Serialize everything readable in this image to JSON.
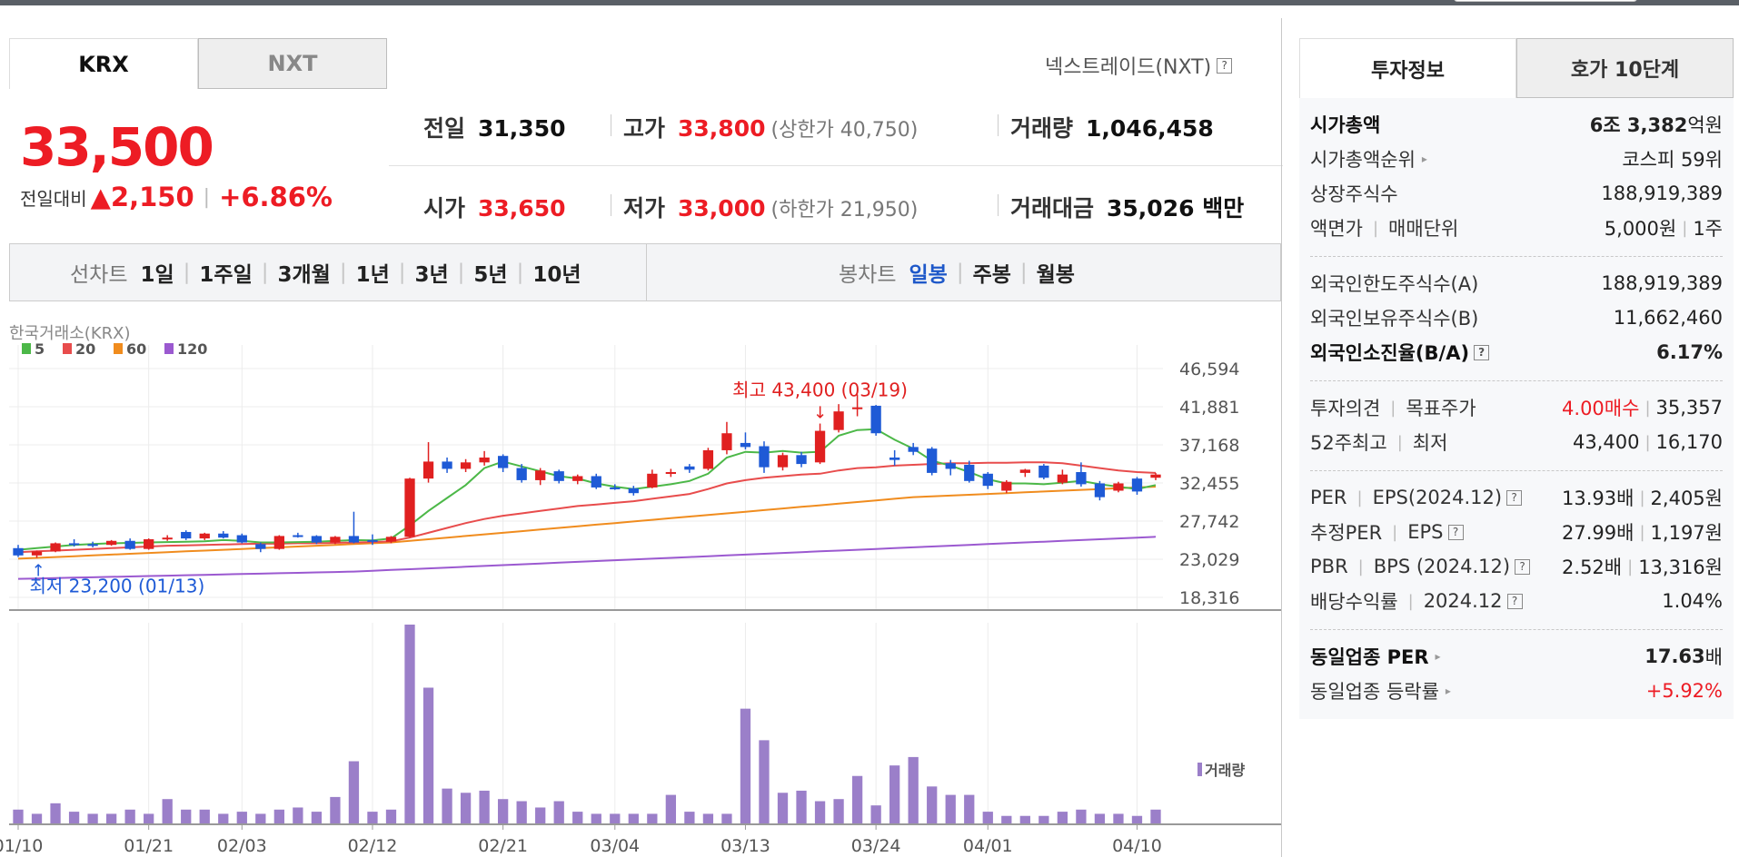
{
  "market_tabs": [
    {
      "label": "KRX",
      "active": true
    },
    {
      "label": "NXT",
      "active": false
    }
  ],
  "nxt_link": "넥스트레이드(NXT)",
  "price": {
    "current": "33,500",
    "change_label": "전일대비",
    "change_arrow": "▲",
    "change_amount": "2,150",
    "change_pct": "+6.86%"
  },
  "stats": {
    "prev": {
      "label": "전일",
      "value": "31,350"
    },
    "high": {
      "label": "고가",
      "value": "33,800",
      "limit": "(상한가 40,750)"
    },
    "volume": {
      "label": "거래량",
      "value": "1,046,458"
    },
    "open": {
      "label": "시가",
      "value": "33,650"
    },
    "low": {
      "label": "저가",
      "value": "33,000",
      "limit": "(하한가 21,950)"
    },
    "amount": {
      "label": "거래대금",
      "value": "35,026 백만"
    }
  },
  "period_bar": {
    "line_label": "선차트",
    "line_items": [
      "1일",
      "1주일",
      "3개월",
      "1년",
      "3년",
      "5년",
      "10년"
    ],
    "candle_label": "봉차트",
    "candle_items": [
      "일봉",
      "주봉",
      "월봉"
    ],
    "candle_selected": 0
  },
  "chart_data": {
    "type": "candlestick",
    "source_label": "한국거래소(KRX)",
    "legend": [
      {
        "name": "5",
        "color": "#4cb848"
      },
      {
        "name": "20",
        "color": "#e84c4c"
      },
      {
        "name": "60",
        "color": "#f08c1e"
      },
      {
        "name": "120",
        "color": "#9b59d0"
      }
    ],
    "volume_label": "거래량",
    "y_ticks": [
      "46,594",
      "41,881",
      "37,168",
      "32,455",
      "27,742",
      "23,029",
      "18,316"
    ],
    "ylim": [
      18316,
      46594
    ],
    "x_ticks": [
      "01/10",
      "01/21",
      "02/03",
      "02/12",
      "02/21",
      "03/04",
      "03/13",
      "03/24",
      "04/01",
      "04/10"
    ],
    "x_tick_index": [
      0,
      7,
      12,
      19,
      26,
      32,
      39,
      46,
      52,
      60
    ],
    "max_annotation": "최고 43,400 (03/19)",
    "max_index": 43,
    "min_annotation": "최저 23,200 (01/13)",
    "min_index": 1,
    "candles": [
      {
        "o": 24400,
        "h": 24800,
        "l": 23300,
        "c": 23500
      },
      {
        "o": 23500,
        "h": 24100,
        "l": 23200,
        "c": 24000
      },
      {
        "o": 24000,
        "h": 25100,
        "l": 23900,
        "c": 25000
      },
      {
        "o": 25000,
        "h": 25500,
        "l": 24600,
        "c": 24900
      },
      {
        "o": 24900,
        "h": 25200,
        "l": 24500,
        "c": 24800
      },
      {
        "o": 24800,
        "h": 25400,
        "l": 24700,
        "c": 25300
      },
      {
        "o": 25300,
        "h": 25600,
        "l": 24200,
        "c": 24300
      },
      {
        "o": 24300,
        "h": 25600,
        "l": 24200,
        "c": 25500
      },
      {
        "o": 25500,
        "h": 26000,
        "l": 25300,
        "c": 25700
      },
      {
        "o": 26400,
        "h": 26600,
        "l": 25400,
        "c": 25600
      },
      {
        "o": 25600,
        "h": 26300,
        "l": 25400,
        "c": 26200
      },
      {
        "o": 26200,
        "h": 26500,
        "l": 25600,
        "c": 25700
      },
      {
        "o": 26000,
        "h": 26200,
        "l": 25000,
        "c": 25100
      },
      {
        "o": 24900,
        "h": 25100,
        "l": 23900,
        "c": 24300
      },
      {
        "o": 24300,
        "h": 26000,
        "l": 24200,
        "c": 25900
      },
      {
        "o": 26000,
        "h": 26300,
        "l": 25700,
        "c": 25800
      },
      {
        "o": 25900,
        "h": 26000,
        "l": 24900,
        "c": 25100
      },
      {
        "o": 25100,
        "h": 25900,
        "l": 24900,
        "c": 25800
      },
      {
        "o": 25900,
        "h": 28900,
        "l": 25000,
        "c": 25100
      },
      {
        "o": 25400,
        "h": 26100,
        "l": 24800,
        "c": 25200
      },
      {
        "o": 25200,
        "h": 25900,
        "l": 25000,
        "c": 25800
      },
      {
        "o": 25800,
        "h": 33100,
        "l": 25700,
        "c": 33000
      },
      {
        "o": 33000,
        "h": 37500,
        "l": 32500,
        "c": 35100
      },
      {
        "o": 35100,
        "h": 35600,
        "l": 33700,
        "c": 34200
      },
      {
        "o": 34200,
        "h": 35400,
        "l": 33800,
        "c": 35000
      },
      {
        "o": 35000,
        "h": 36400,
        "l": 34600,
        "c": 35600
      },
      {
        "o": 35800,
        "h": 36000,
        "l": 33800,
        "c": 34300
      },
      {
        "o": 34300,
        "h": 34800,
        "l": 32500,
        "c": 32800
      },
      {
        "o": 32800,
        "h": 34300,
        "l": 32200,
        "c": 34000
      },
      {
        "o": 33900,
        "h": 34100,
        "l": 32400,
        "c": 32700
      },
      {
        "o": 32700,
        "h": 33500,
        "l": 32300,
        "c": 33300
      },
      {
        "o": 33300,
        "h": 33600,
        "l": 31700,
        "c": 31900
      },
      {
        "o": 31900,
        "h": 32300,
        "l": 31600,
        "c": 31800
      },
      {
        "o": 31800,
        "h": 32100,
        "l": 30900,
        "c": 31200
      },
      {
        "o": 31900,
        "h": 34100,
        "l": 31800,
        "c": 33600
      },
      {
        "o": 33700,
        "h": 34200,
        "l": 33200,
        "c": 33800
      },
      {
        "o": 34500,
        "h": 34800,
        "l": 33700,
        "c": 34100
      },
      {
        "o": 34200,
        "h": 36800,
        "l": 34000,
        "c": 36500
      },
      {
        "o": 36500,
        "h": 40000,
        "l": 36000,
        "c": 38600
      },
      {
        "o": 37400,
        "h": 38700,
        "l": 36600,
        "c": 36900
      },
      {
        "o": 37000,
        "h": 37600,
        "l": 33700,
        "c": 34400
      },
      {
        "o": 34400,
        "h": 36200,
        "l": 34000,
        "c": 35900
      },
      {
        "o": 35900,
        "h": 36300,
        "l": 34400,
        "c": 34800
      },
      {
        "o": 35000,
        "h": 39800,
        "l": 34800,
        "c": 38900
      },
      {
        "o": 39000,
        "h": 42200,
        "l": 38700,
        "c": 41300
      },
      {
        "o": 41800,
        "h": 43400,
        "l": 40700,
        "c": 41800
      },
      {
        "o": 42000,
        "h": 42100,
        "l": 38300,
        "c": 38600
      },
      {
        "o": 35600,
        "h": 36500,
        "l": 34600,
        "c": 35300
      },
      {
        "o": 36900,
        "h": 37400,
        "l": 35900,
        "c": 36300
      },
      {
        "o": 36700,
        "h": 36900,
        "l": 33400,
        "c": 33700
      },
      {
        "o": 34900,
        "h": 35300,
        "l": 33400,
        "c": 34200
      },
      {
        "o": 34700,
        "h": 35200,
        "l": 32500,
        "c": 32700
      },
      {
        "o": 33600,
        "h": 33800,
        "l": 31700,
        "c": 32100
      },
      {
        "o": 31500,
        "h": 32800,
        "l": 31200,
        "c": 32600
      },
      {
        "o": 33700,
        "h": 34200,
        "l": 33200,
        "c": 34100
      },
      {
        "o": 34600,
        "h": 34800,
        "l": 32900,
        "c": 33100
      },
      {
        "o": 32500,
        "h": 34100,
        "l": 32300,
        "c": 33500
      },
      {
        "o": 33800,
        "h": 35000,
        "l": 32000,
        "c": 32300
      },
      {
        "o": 32400,
        "h": 32700,
        "l": 30300,
        "c": 30700
      },
      {
        "o": 31500,
        "h": 32600,
        "l": 31300,
        "c": 32400
      },
      {
        "o": 33000,
        "h": 33200,
        "l": 31000,
        "c": 31400
      },
      {
        "o": 33100,
        "h": 33700,
        "l": 32800,
        "c": 33500
      }
    ],
    "ma5": [
      24200,
      24400,
      24600,
      24800,
      24900,
      25000,
      25050,
      25100,
      25150,
      25200,
      25250,
      25400,
      25300,
      25100,
      25100,
      25150,
      25200,
      25300,
      25400,
      25350,
      25600,
      27200,
      29000,
      30600,
      32200,
      34300,
      35100,
      34500,
      33900,
      33300,
      33000,
      32400,
      32000,
      31700,
      32000,
      32300,
      32700,
      33600,
      35600,
      36300,
      36200,
      36400,
      36200,
      36300,
      38300,
      39000,
      39100,
      37800,
      36700,
      35200,
      34600,
      33800,
      32900,
      32400,
      32400,
      32300,
      32500,
      32700,
      32300,
      32000,
      31700,
      32200
    ],
    "ma20": [
      23900,
      24000,
      24100,
      24200,
      24300,
      24400,
      24500,
      24600,
      24700,
      24750,
      24800,
      24850,
      24900,
      24950,
      24950,
      25000,
      25000,
      25050,
      25100,
      25150,
      25250,
      25700,
      26300,
      26900,
      27500,
      28000,
      28400,
      28700,
      29000,
      29300,
      29600,
      29800,
      30000,
      30200,
      30500,
      30800,
      31100,
      31700,
      32400,
      32800,
      33100,
      33300,
      33500,
      33600,
      34000,
      34300,
      34400,
      34600,
      34700,
      34800,
      34900,
      34900,
      34950,
      34950,
      35000,
      35000,
      34900,
      34600,
      34300,
      34000,
      33800,
      33700
    ],
    "ma60": [
      23100,
      23200,
      23300,
      23400,
      23500,
      23600,
      23700,
      23800,
      23900,
      24000,
      24100,
      24200,
      24300,
      24400,
      24500,
      24600,
      24700,
      24800,
      24900,
      25000,
      25100,
      25300,
      25500,
      25700,
      25900,
      26100,
      26300,
      26500,
      26700,
      26900,
      27100,
      27300,
      27500,
      27700,
      27900,
      28100,
      28300,
      28500,
      28700,
      28900,
      29100,
      29300,
      29500,
      29700,
      29900,
      30100,
      30300,
      30500,
      30700,
      30800,
      30900,
      31000,
      31100,
      31200,
      31300,
      31400,
      31500,
      31600,
      31700,
      31800,
      31900,
      32000
    ],
    "ma120": [
      20600,
      20650,
      20700,
      20750,
      20800,
      20850,
      20900,
      20950,
      21000,
      21050,
      21100,
      21150,
      21200,
      21250,
      21300,
      21350,
      21400,
      21450,
      21500,
      21600,
      21700,
      21800,
      21900,
      22000,
      22100,
      22200,
      22300,
      22400,
      22500,
      22600,
      22700,
      22800,
      22900,
      23000,
      23100,
      23200,
      23300,
      23400,
      23500,
      23600,
      23700,
      23800,
      23900,
      24000,
      24100,
      24200,
      24300,
      24400,
      24500,
      24600,
      24700,
      24800,
      24900,
      25000,
      25100,
      25200,
      25300,
      25400,
      25500,
      25600,
      25700,
      25800
    ],
    "volumes": [
      7,
      5,
      10,
      6,
      5,
      5,
      7,
      5,
      12,
      7,
      7,
      5,
      6,
      5,
      7,
      8,
      6,
      13,
      30,
      6,
      7,
      95,
      65,
      17,
      15,
      16,
      12,
      11,
      8,
      11,
      6,
      5,
      5,
      5,
      5,
      14,
      6,
      5,
      5,
      55,
      40,
      15,
      16,
      11,
      12,
      23,
      9,
      28,
      32,
      18,
      14,
      14,
      6,
      4,
      4,
      4,
      6,
      7,
      5,
      5,
      4,
      7
    ]
  },
  "right_panel": {
    "tabs": [
      {
        "label": "투자정보",
        "active": true
      },
      {
        "label": "호가 10단계",
        "active": false
      }
    ],
    "sections": [
      {
        "rows": [
          {
            "key": "시가총액",
            "bold_key": true,
            "value_bold": "6조 3,382",
            "value_suffix": "억원"
          },
          {
            "key": "시가총액순위",
            "arrow": true,
            "value": "코스피 59위"
          },
          {
            "key": "상장주식수",
            "value": "188,919,389"
          },
          {
            "key": "액면가",
            "key2": "매매단위",
            "value": "5,000원",
            "value2": "1주"
          }
        ]
      },
      {
        "rows": [
          {
            "key": "외국인한도주식수(A)",
            "value": "188,919,389"
          },
          {
            "key": "외국인보유주식수(B)",
            "value": "11,662,460"
          },
          {
            "key": "외국인소진율(B/A)",
            "bold_key": true,
            "help": true,
            "value_bold": "6.17%"
          }
        ]
      },
      {
        "rows": [
          {
            "key": "투자의견",
            "key2": "목표주가",
            "value_red": "4.00매수",
            "value2": "35,357"
          },
          {
            "key": "52주최고",
            "key2": "최저",
            "value": "43,400",
            "value2": "16,170"
          }
        ]
      },
      {
        "rows": [
          {
            "key": "PER",
            "key2": "EPS(2024.12)",
            "help": true,
            "value": "13.93배",
            "value2": "2,405원"
          },
          {
            "key": "추정PER",
            "key2": "EPS",
            "help": true,
            "value": "27.99배",
            "value2": "1,197원"
          },
          {
            "key": "PBR",
            "key2": "BPS (2024.12)",
            "help": true,
            "value": "2.52배",
            "value2": "13,316원"
          },
          {
            "key": "배당수익률",
            "key2": "2024.12",
            "help": true,
            "value": "1.04%"
          }
        ]
      },
      {
        "rows": [
          {
            "key": "동일업종 PER",
            "bold_key": true,
            "arrow": true,
            "value_bold": "17.63",
            "value_suffix": "배"
          },
          {
            "key": "동일업종 등락률",
            "arrow": true,
            "value_red": "+5.92%"
          }
        ]
      }
    ]
  }
}
